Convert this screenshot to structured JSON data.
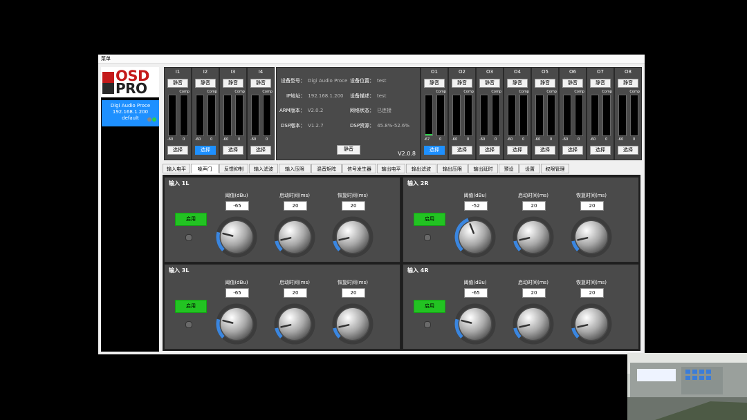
{
  "menu_label": "菜单",
  "device": {
    "name": "Digi Audio Proce",
    "ip": "192.168.1.200",
    "preset": "default"
  },
  "logo": {
    "line1": "OSD",
    "line2": "PRO"
  },
  "inputs": [
    {
      "name": "I1",
      "mute": "静音",
      "comp": "Comp",
      "scale_min": "-60",
      "scale_max": "0",
      "select": "选择",
      "selected": false
    },
    {
      "name": "I2",
      "mute": "静音",
      "comp": "Comp",
      "scale_min": "-60",
      "scale_max": "0",
      "select": "选择",
      "selected": true
    },
    {
      "name": "I3",
      "mute": "静音",
      "comp": "Comp",
      "scale_min": "-60",
      "scale_max": "0",
      "select": "选择",
      "selected": false
    },
    {
      "name": "I4",
      "mute": "静音",
      "comp": "Comp",
      "scale_min": "-60",
      "scale_max": "0",
      "select": "选择",
      "selected": false
    }
  ],
  "outputs": [
    {
      "name": "O1",
      "mute": "静音",
      "comp": "Comp",
      "scale_min": "-67",
      "scale_max": "0",
      "select": "选择",
      "selected": true
    },
    {
      "name": "O2",
      "mute": "静音",
      "comp": "Comp",
      "scale_min": "-60",
      "scale_max": "0",
      "select": "选择",
      "selected": false
    },
    {
      "name": "O3",
      "mute": "静音",
      "comp": "Comp",
      "scale_min": "-60",
      "scale_max": "0",
      "select": "选择",
      "selected": false
    },
    {
      "name": "O4",
      "mute": "静音",
      "comp": "Comp",
      "scale_min": "-60",
      "scale_max": "0",
      "select": "选择",
      "selected": false
    },
    {
      "name": "O5",
      "mute": "静音",
      "comp": "Comp",
      "scale_min": "-60",
      "scale_max": "0",
      "select": "选择",
      "selected": false
    },
    {
      "name": "O6",
      "mute": "静音",
      "comp": "Comp",
      "scale_min": "-60",
      "scale_max": "0",
      "select": "选择",
      "selected": false
    },
    {
      "name": "O7",
      "mute": "静音",
      "comp": "Comp",
      "scale_min": "-60",
      "scale_max": "0",
      "select": "选择",
      "selected": false
    },
    {
      "name": "O8",
      "mute": "静音",
      "comp": "Comp",
      "scale_min": "-60",
      "scale_max": "0",
      "select": "选择",
      "selected": false
    }
  ],
  "info": {
    "model_label": "设备型号：",
    "model_value": "Digi Audio Proce",
    "location_label": "设备位置：",
    "location_value": "test",
    "ip_label": "IP地址：",
    "ip_value": "192.168.1.200",
    "desc_label": "设备描述：",
    "desc_value": "test",
    "arm_label": "ARM版本：",
    "arm_value": "V2.0.2",
    "net_label": "网络状态：",
    "net_value": "已连接",
    "dsp_label": "DSP版本：",
    "dsp_value": "V1.2.7",
    "res_label": "DSP资源：",
    "res_value": "45.8%-52.6%",
    "mute_all": "静音",
    "version": "V2.0.8"
  },
  "tabs": [
    "输入电平",
    "噪声门",
    "反馈抑制",
    "输入滤波",
    "输入压限",
    "混音矩阵",
    "信号发生器",
    "输出电平",
    "输出滤波",
    "输出压限",
    "输出延时",
    "预设",
    "设置",
    "权限管理"
  ],
  "active_tab": 1,
  "gates": [
    {
      "title": "输入 1L",
      "apply": "启用",
      "threshold_label": "阈值(dBu)",
      "attack_label": "启动时间(ms)",
      "release_label": "恢复时间(ms)",
      "threshold": "-65",
      "attack": "20",
      "release": "20",
      "threshold_level": 0.22,
      "attack_level": 0.12,
      "release_level": 0.12
    },
    {
      "title": "输入 2R",
      "apply": "启用",
      "threshold_label": "阈值(dBu)",
      "attack_label": "启动时间(ms)",
      "release_label": "恢复时间(ms)",
      "threshold": "-52",
      "attack": "20",
      "release": "20",
      "threshold_level": 0.42,
      "attack_level": 0.12,
      "release_level": 0.12
    },
    {
      "title": "输入 3L",
      "apply": "启用",
      "threshold_label": "阈值(dBu)",
      "attack_label": "启动时间(ms)",
      "release_label": "恢复时间(ms)",
      "threshold": "-65",
      "attack": "20",
      "release": "20",
      "threshold_level": 0.22,
      "attack_level": 0.12,
      "release_level": 0.12
    },
    {
      "title": "输入 4R",
      "apply": "启用",
      "threshold_label": "阈值(dBu)",
      "attack_label": "启动时间(ms)",
      "release_label": "恢复时间(ms)",
      "threshold": "-65",
      "attack": "20",
      "release": "20",
      "threshold_level": 0.22,
      "attack_level": 0.12,
      "release_level": 0.12
    }
  ],
  "colors": {
    "accent": "#1e90ff",
    "apply_green": "#22c322",
    "panel": "#4a4a4a"
  }
}
